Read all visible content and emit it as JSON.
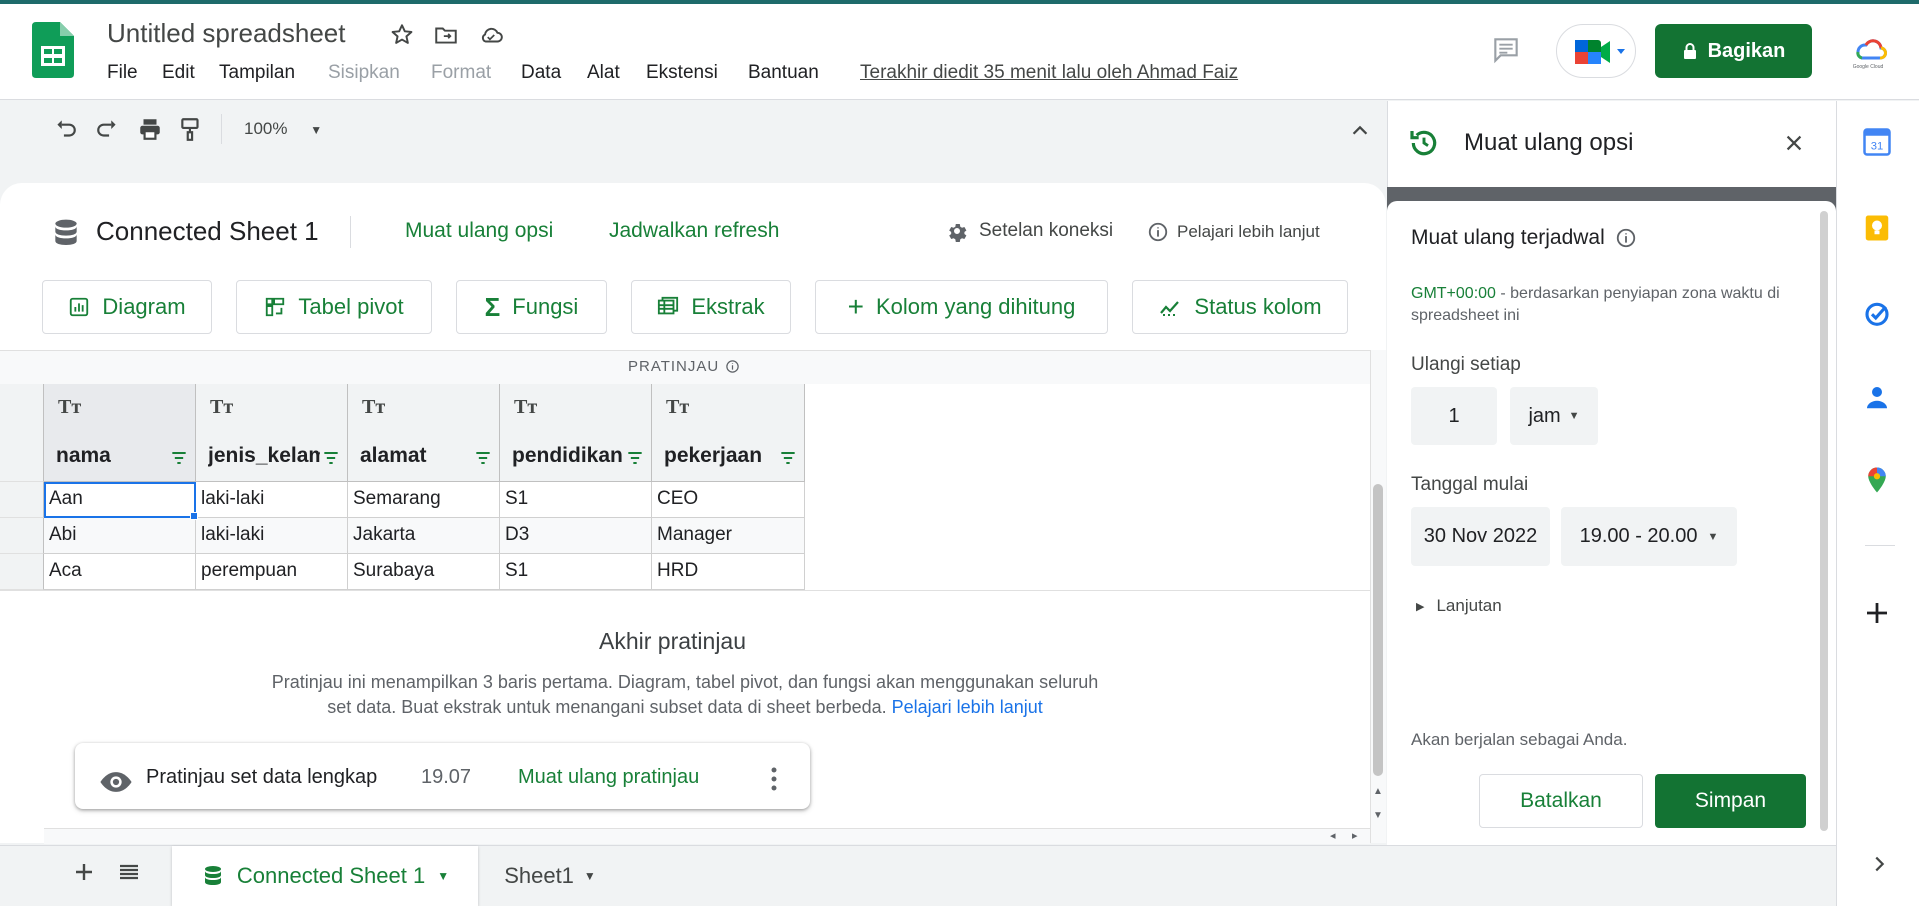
{
  "header": {
    "doc_title": "Untitled spreadsheet",
    "menu": [
      "File",
      "Edit",
      "Tampilan",
      "Sisipkan",
      "Format",
      "Data",
      "Alat",
      "Ekstensi",
      "Bantuan"
    ],
    "menu_disabled": [
      "Sisipkan",
      "Format"
    ],
    "last_edit": "Terakhir diedit 35 menit lalu oleh Ahmad Faiz",
    "share_label": "Bagikan",
    "gcloud_label": "Google Cloud"
  },
  "toolbar": {
    "zoom": "100%"
  },
  "connected": {
    "title": "Connected Sheet 1",
    "reload_options_link": "Muat ulang opsi",
    "schedule_link": "Jadwalkan refresh",
    "settings_label": "Setelan koneksi",
    "learn_more_label": "Pelajari lebih lanjut",
    "chips": [
      "Diagram",
      "Tabel pivot",
      "Fungsi",
      "Ekstrak",
      "Kolom yang dihitung",
      "Status kolom"
    ],
    "preview_label": "PRATINJAU"
  },
  "grid": {
    "type_glyph": "Tт",
    "columns": [
      "nama",
      "jenis_kelamin",
      "alamat",
      "pendidikan",
      "pekerjaan"
    ],
    "rows": [
      [
        "Aan",
        "laki-laki",
        "Semarang",
        "S1",
        "CEO"
      ],
      [
        "Abi",
        "laki-laki",
        "Jakarta",
        "D3",
        "Manager"
      ],
      [
        "Aca",
        "perempuan",
        "Surabaya",
        "S1",
        "HRD"
      ]
    ]
  },
  "end_preview": {
    "title": "Akhir pratinjau",
    "description": "Pratinjau ini menampilkan 3 baris pertama. Diagram, tabel pivot, dan fungsi akan menggunakan seluruh set data. Buat ekstrak untuk menangani subset data di sheet berbeda.",
    "link": "Pelajari lebih lanjut"
  },
  "full_preview": {
    "label": "Pratinjau set data lengkap",
    "time": "19.07",
    "reload_label": "Muat ulang pratinjau"
  },
  "tabs": [
    {
      "label": "Connected Sheet 1",
      "active": true
    },
    {
      "label": "Sheet1",
      "active": false
    }
  ],
  "panel": {
    "title": "Muat ulang opsi",
    "scheduled_title": "Muat ulang terjadwal",
    "tz_highlight": "GMT+00:00",
    "tz_text": " - berdasarkan penyiapan zona waktu di spreadsheet ini",
    "repeat_label": "Ulangi setiap",
    "repeat_value": "1",
    "repeat_unit": "jam",
    "start_label": "Tanggal mulai",
    "start_date": "30 Nov 2022",
    "start_time": "19.00 - 20.00",
    "advanced_label": "Lanjutan",
    "run_as": "Akan berjalan sebagai Anda.",
    "cancel_label": "Batalkan",
    "save_label": "Simpan"
  },
  "rail": [
    "calendar-icon",
    "keep-icon",
    "tasks-icon",
    "contacts-icon",
    "maps-icon",
    "add-icon"
  ],
  "colors": {
    "brand_green": "#137333",
    "link_green": "#188038",
    "link_blue": "#1a73e8"
  }
}
